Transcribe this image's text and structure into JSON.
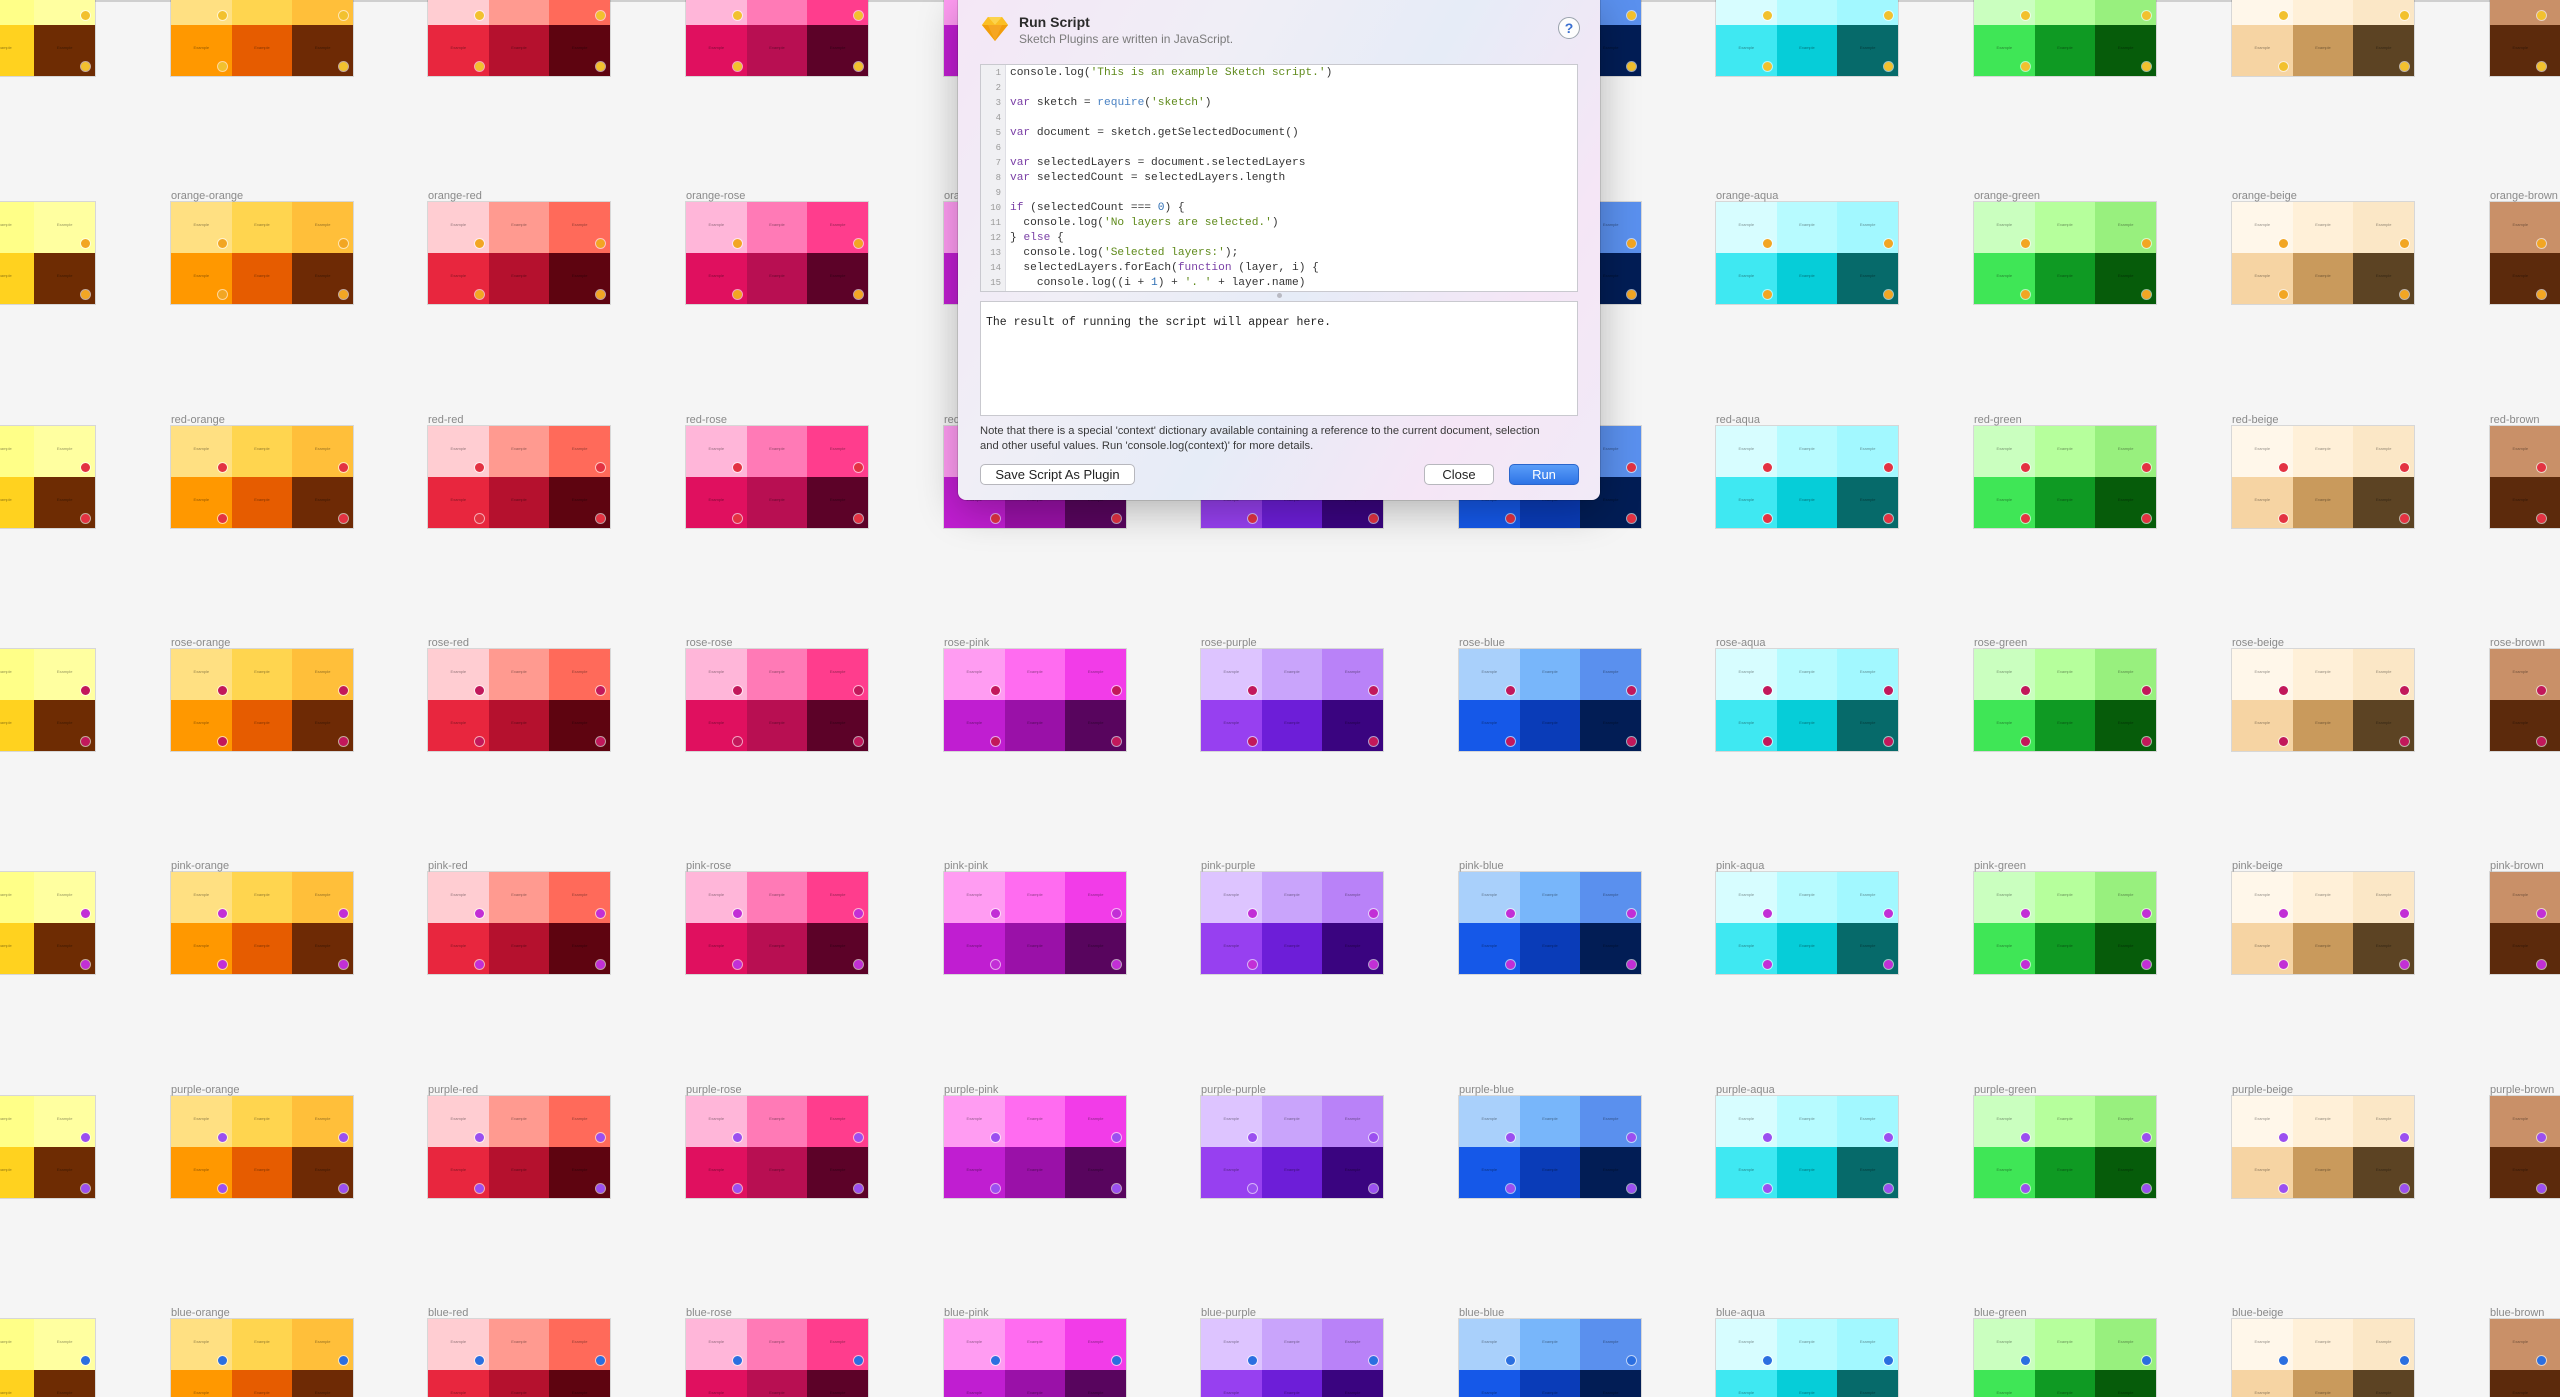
{
  "canvas": {
    "label_pattern": "{row}-{col}",
    "row_names": [
      "",
      "orange",
      "red",
      "rose",
      "pink",
      "purple",
      "blue"
    ],
    "col_names": [
      "",
      "orange",
      "red",
      "rose",
      "pink",
      "purple",
      "blue",
      "aqua",
      "green",
      "beige",
      "brown"
    ],
    "cell_text": "Example",
    "row_dot_colors": [
      "#f2c12e",
      "#f2a623",
      "#e33242",
      "#c2185b",
      "#c22fd6",
      "#9b4ff0",
      "#2b6fe0"
    ],
    "palettes": {
      "yellow": [
        "#ffee99",
        "#ffff88",
        "#ffffa0",
        "#f2c618",
        "#ffd21f",
        "#6e2c03"
      ],
      "orange": [
        "#ffe082",
        "#ffd54f",
        "#ffbf3a",
        "#ff9800",
        "#e65c00",
        "#6e2a05"
      ],
      "red": [
        "#ffcdd2",
        "#ff9a90",
        "#ff6a5a",
        "#e8263e",
        "#b5112e",
        "#5e0410"
      ],
      "rose": [
        "#ffb6d9",
        "#ff7ab6",
        "#ff3d8d",
        "#e0105f",
        "#b80f52",
        "#5c0228"
      ],
      "pink": [
        "#ff9cf2",
        "#ff6cf0",
        "#f23ce8",
        "#c01ed1",
        "#9a11a8",
        "#58055e"
      ],
      "purple": [
        "#ddc4ff",
        "#c9a4fb",
        "#b982f8",
        "#9740f0",
        "#6d1ed8",
        "#3a0480"
      ],
      "blue": [
        "#a9d0fb",
        "#78b6fa",
        "#5a90ee",
        "#1558e8",
        "#0a3cb8",
        "#021d55"
      ],
      "aqua": [
        "#d7fdff",
        "#b7fbff",
        "#a2f8ff",
        "#3fe8f2",
        "#06cdd8",
        "#066a6a"
      ],
      "green": [
        "#caffbf",
        "#b6ff9c",
        "#98f07e",
        "#3fe656",
        "#0f9a23",
        "#065c0a"
      ],
      "beige": [
        "#fff7ea",
        "#fff0d8",
        "#fbe7c6",
        "#f6d4a3",
        "#c99a5c",
        "#5c4323"
      ],
      "brown": [
        "#c99068",
        "#c99068",
        "#c99068",
        "#5c2a0c",
        "#5c2a0c",
        "#5c2a0c"
      ]
    }
  },
  "dialog": {
    "title": "Run Script",
    "subtitle": "Sketch Plugins are written in JavaScript.",
    "help_label": "?",
    "code_lines": [
      "console.log('This is an example Sketch script.')",
      "",
      "var sketch = require('sketch')",
      "",
      "var document = sketch.getSelectedDocument()",
      "",
      "var selectedLayers = document.selectedLayers",
      "var selectedCount = selectedLayers.length",
      "",
      "if (selectedCount === 0) {",
      "  console.log('No layers are selected.')",
      "} else {",
      "  console.log('Selected layers:');",
      "  selectedLayers.forEach(function (layer, i) {",
      "    console.log((i + 1) + '. ' + layer.name)"
    ],
    "output_text": "The result of running the script will appear here.",
    "note_line1": "Note that there is a special 'context' dictionary available containing a reference to the current document, selection",
    "note_line2": "and other useful values. Run 'console.log(context)' for more details.",
    "save_label": "Save Script As Plugin",
    "close_label": "Close",
    "run_label": "Run"
  }
}
